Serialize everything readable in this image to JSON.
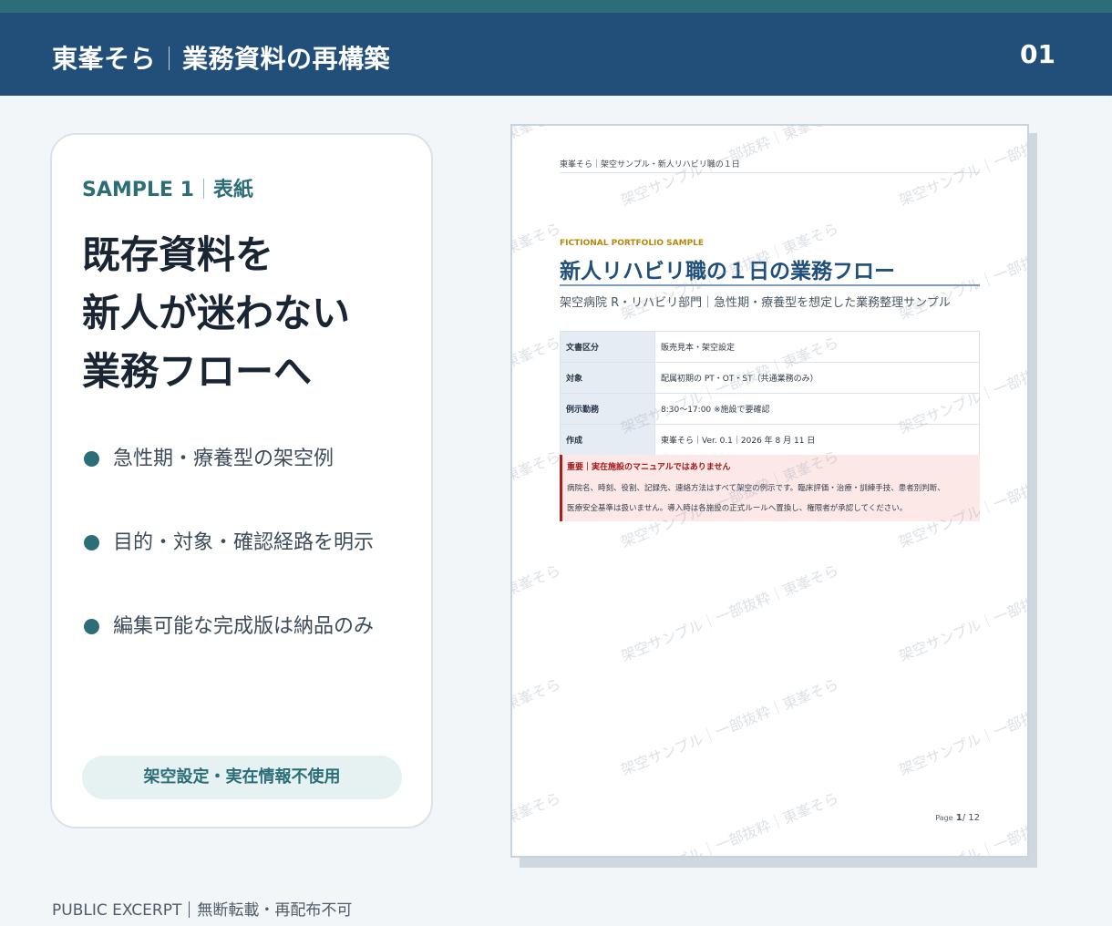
{
  "header": {
    "author": "東峯そら",
    "title": "業務資料の再構築",
    "page_number": "01"
  },
  "card": {
    "sample_label": "SAMPLE 1",
    "sample_type": "表紙",
    "headline": [
      "既存資料を",
      "新人が迷わない",
      "業務フローへ"
    ],
    "bullets": [
      "急性期・療養型の架空例",
      "目的・対象・確認経路を明示",
      "編集可能な完成版は納品のみ"
    ],
    "note": "架空設定・実在情報不使用"
  },
  "document": {
    "running_header": "東峯そら｜架空サンプル・新人リハビリ職の１日",
    "kicker": "FICTIONAL PORTFOLIO SAMPLE",
    "title": "新人リハビリ職の１日の業務フロー",
    "subtitle": "架空病院 R・リハビリ部門｜急性期・療養型を想定した業務整理サンプル",
    "info_rows": [
      {
        "key": "文書区分",
        "value": "販売見本・架空設定"
      },
      {
        "key": "対象",
        "value": "配属初期の PT・OT・ST（共通業務のみ）"
      },
      {
        "key": "例示勤務",
        "value": "8:30〜17:00 ※施設で要確認"
      },
      {
        "key": "作成",
        "value": "東峯そら｜Ver. 0.1｜2026 年 8 月 11 日"
      }
    ],
    "alert": {
      "title": "重要｜実在施設のマニュアルではありません",
      "line1": "病院名、時刻、役割、記録先、連絡方法はすべて架空の例示です。臨床評価・治療・訓練手技、患者別判断、",
      "line2": "医療安全基準は扱いません。導入時は各施設の正式ルールへ置換し、権限者が承認してください。"
    },
    "page_label": "Page",
    "page_current": "1",
    "page_total": "/ 12",
    "watermarks": [
      "架空サンプル｜一部抜粋｜東峯そら"
    ]
  },
  "footer": {
    "left": "PUBLIC EXCERPT",
    "right": "無断転載・再配布不可"
  }
}
